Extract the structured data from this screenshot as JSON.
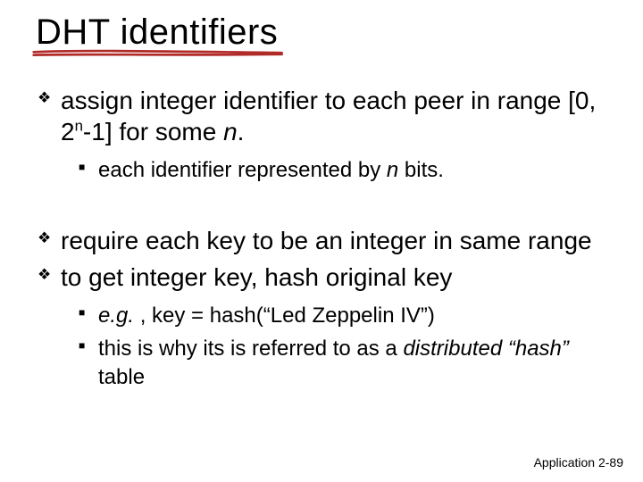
{
  "title": "DHT identifiers",
  "bullets": {
    "b1_pre": "assign integer identifier to each peer in range [0, 2",
    "b1_sup": "n",
    "b1_mid": "-1] for some ",
    "b1_ital": "n",
    "b1_post": ".",
    "b1a_pre": "each identifier represented by ",
    "b1a_ital": "n",
    "b1a_post": " bits.",
    "b2": "require each key to be an integer in same range",
    "b3": "to get integer key, hash original key",
    "b3a_pre": "e.g.",
    "b3a_post": " , key = hash(“Led Zeppelin IV”)",
    "b3b_pre": "this is why its is referred to as a ",
    "b3b_ital": "distributed “hash”",
    "b3b_post": " table"
  },
  "footer": "Application  2-89"
}
